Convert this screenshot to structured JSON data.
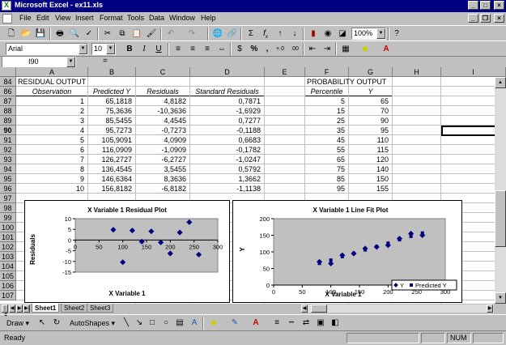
{
  "window": {
    "title": "Microsoft Excel - ex11.xls"
  },
  "menu": [
    "File",
    "Edit",
    "View",
    "Insert",
    "Format",
    "Tools",
    "Data",
    "Window",
    "Help"
  ],
  "toolbar": {
    "zoom": "100%",
    "sum_icon": "Σ",
    "fx_icon": "f",
    "fx_sub": "x"
  },
  "format": {
    "font": "Arial",
    "size": "10",
    "bold": "B",
    "italic": "I",
    "underline": "U",
    "percent": "%",
    "comma": ","
  },
  "formula_bar": {
    "name_box": "I90",
    "equals": "=",
    "formula": ""
  },
  "columns": [
    "A",
    "B",
    "C",
    "D",
    "E",
    "F",
    "G",
    "H",
    "I"
  ],
  "rows": [
    "84",
    "86",
    "87",
    "88",
    "89",
    "90",
    "91",
    "92",
    "93",
    "94",
    "95",
    "96",
    "97",
    "98",
    "99",
    "100",
    "101",
    "102",
    "103",
    "104",
    "105",
    "106",
    "107"
  ],
  "residual_output": {
    "title": "RESIDUAL OUTPUT",
    "headers": [
      "Observation",
      "Predicted Y",
      "Residuals",
      "Standard Residuals"
    ],
    "rows": [
      [
        "1",
        "65,1818",
        "4,8182",
        "0,7871"
      ],
      [
        "2",
        "75,3636",
        "-10,3636",
        "-1,6929"
      ],
      [
        "3",
        "85,5455",
        "4,4545",
        "0,7277"
      ],
      [
        "4",
        "95,7273",
        "-0,7273",
        "-0,1188"
      ],
      [
        "5",
        "105,9091",
        "4,0909",
        "0,6683"
      ],
      [
        "6",
        "116,0909",
        "-1,0909",
        "-0,1782"
      ],
      [
        "7",
        "126,2727",
        "-6,2727",
        "-1,0247"
      ],
      [
        "8",
        "136,4545",
        "3,5455",
        "0,5792"
      ],
      [
        "9",
        "146,6364",
        "8,3636",
        "1,3662"
      ],
      [
        "10",
        "156,8182",
        "-6,8182",
        "-1,1138"
      ]
    ]
  },
  "probability_output": {
    "title": "PROBABILITY OUTPUT",
    "headers": [
      "Percentile",
      "Y"
    ],
    "rows": [
      [
        "5",
        "65"
      ],
      [
        "15",
        "70"
      ],
      [
        "25",
        "90"
      ],
      [
        "35",
        "95"
      ],
      [
        "45",
        "110"
      ],
      [
        "55",
        "115"
      ],
      [
        "65",
        "120"
      ],
      [
        "75",
        "140"
      ],
      [
        "85",
        "150"
      ],
      [
        "95",
        "155"
      ]
    ]
  },
  "chart_data": [
    {
      "type": "scatter",
      "title": "X Variable 1  Residual Plot",
      "xlabel": "X Variable 1",
      "ylabel": "Residuals",
      "xlim": [
        0,
        300
      ],
      "ylim": [
        -15,
        10
      ],
      "xticks": [
        "0",
        "50",
        "100",
        "150",
        "200",
        "250",
        "300"
      ],
      "yticks": [
        "10",
        "5",
        "0",
        "-5",
        "-10",
        "-15"
      ],
      "series": [
        {
          "x": [
            80,
            100,
            120,
            140,
            160,
            180,
            200,
            220,
            240,
            260
          ],
          "y": [
            4.8182,
            -10.3636,
            4.4545,
            -0.7273,
            4.0909,
            -1.0909,
            -6.2727,
            3.5455,
            8.3636,
            -6.8182
          ]
        }
      ],
      "colors": {
        "plot_bg": "#c0c0c0",
        "marker": "#000080"
      }
    },
    {
      "type": "scatter",
      "title": "X Variable 1 Line Fit  Plot",
      "xlabel": "X Variable 1",
      "ylabel": "Y",
      "xlim": [
        0,
        300
      ],
      "ylim": [
        0,
        200
      ],
      "xticks": [
        "0",
        "50",
        "100",
        "150",
        "200",
        "250",
        "300"
      ],
      "yticks": [
        "200",
        "150",
        "100",
        "50",
        "0"
      ],
      "series": [
        {
          "name": "Y",
          "x": [
            80,
            100,
            120,
            140,
            160,
            180,
            200,
            220,
            240,
            260
          ],
          "y": [
            70,
            65,
            90,
            95,
            110,
            115,
            120,
            140,
            155,
            150
          ]
        },
        {
          "name": "Predicted Y",
          "x": [
            80,
            100,
            120,
            140,
            160,
            180,
            200,
            220,
            240,
            260
          ],
          "y": [
            65.1818,
            75.3636,
            85.5455,
            95.7273,
            105.9091,
            116.0909,
            126.2727,
            136.4545,
            146.6364,
            156.8182
          ]
        }
      ],
      "legend": "bottom-right",
      "colors": {
        "plot_bg": "#c0c0c0",
        "marker": "#000080"
      }
    }
  ],
  "sheets": [
    "Sheet1",
    "Sheet2",
    "Sheet3"
  ],
  "active_sheet": "Sheet1",
  "drawing": {
    "draw_label": "Draw",
    "autoshapes_label": "AutoShapes"
  },
  "status": {
    "text": "Ready",
    "num": "NUM"
  },
  "colors": {
    "titlebar": "#000080",
    "chrome": "#c0c0c0"
  }
}
